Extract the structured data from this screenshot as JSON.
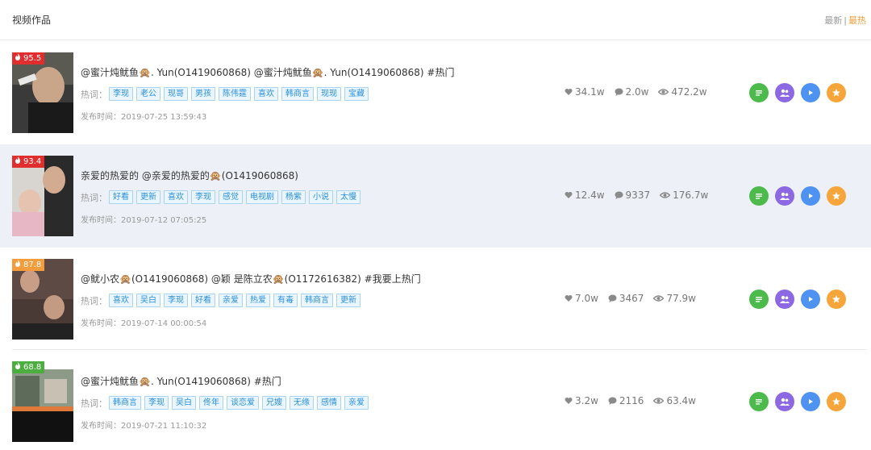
{
  "header": {
    "title": "视频作品",
    "sort_newest": "最新",
    "sort_divider": "|",
    "sort_hottest": "最热"
  },
  "keyword_label": "热词：",
  "colors": {
    "tag_border": "#a8d3f2",
    "tag_bg": "#e9f5ff",
    "tag_text": "#2a8fd8",
    "sort_active": "#f39c3c",
    "row_alt_bg": "#edf0f6"
  },
  "items": [
    {
      "score": "95.5",
      "badge_color": "#e02e2e",
      "desc": "@蜜汁炖鱿鱼🙊. Yun(O1419060868) @蜜汁炖鱿鱼🙊. Yun(O1419060868) #热门",
      "keywords": [
        "李现",
        "老公",
        "现哥",
        "男孩",
        "陈伟霆",
        "喜欢",
        "韩商言",
        "现现",
        "宝藏"
      ],
      "time": "发布时间：2019-07-25 13:59:43",
      "likes": "34.1w",
      "comments": "2.0w",
      "views": "472.2w"
    },
    {
      "score": "93.4",
      "badge_color": "#e02e2e",
      "desc": "亲爱的热爱的 @亲爱的热爱的🙊(O1419060868)",
      "keywords": [
        "好看",
        "更新",
        "喜欢",
        "李现",
        "感觉",
        "电视剧",
        "杨紫",
        "小说",
        "太慢"
      ],
      "time": "发布时间：2019-07-12 07:05:25",
      "likes": "12.4w",
      "comments": "9337",
      "views": "176.7w"
    },
    {
      "score": "87.8",
      "badge_color": "#f39c3c",
      "desc": "@鱿小农🙊(O1419060868) @颖 是陈立农🙊(O1172616382) #我要上热门",
      "keywords": [
        "喜欢",
        "吴白",
        "李现",
        "好看",
        "亲爱",
        "热爱",
        "有毒",
        "韩商言",
        "更新"
      ],
      "time": "发布时间：2019-07-14 00:00:54",
      "likes": "7.0w",
      "comments": "3467",
      "views": "77.9w"
    },
    {
      "score": "68.8",
      "badge_color": "#4cae3f",
      "desc": "@蜜汁炖鱿鱼🙊. Yun(O1419060868) #热门",
      "keywords": [
        "韩商言",
        "李现",
        "吴白",
        "佟年",
        "谈恋爱",
        "兄嫂",
        "无缘",
        "感情",
        "亲爱"
      ],
      "time": "发布时间：2019-07-21 11:10:32",
      "likes": "3.2w",
      "comments": "2116",
      "views": "63.4w"
    }
  ],
  "action_icons": [
    "list-icon",
    "group-icon",
    "play-icon",
    "star-icon"
  ]
}
